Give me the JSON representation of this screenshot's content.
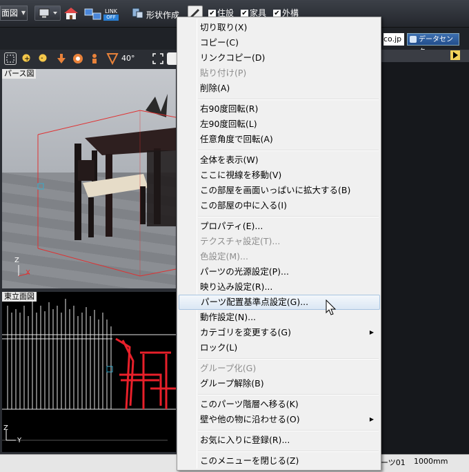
{
  "toolbar": {
    "view_select": "面図",
    "link_label": "LINK",
    "link_state": "OFF",
    "shape_label": "形状作成",
    "checks": [
      {
        "label": "住設",
        "checked": true
      },
      {
        "label": "家具",
        "checked": true
      },
      {
        "label": "外構",
        "checked": true
      }
    ]
  },
  "urlbar": {
    "url_text": "co.jp",
    "datacenter_label": "データセンター"
  },
  "viewbar": {
    "angle": "40°"
  },
  "panes": {
    "perspective_label": "パース図",
    "elevation_label": "東立面図"
  },
  "axes": {
    "z": "Z",
    "x": "X",
    "y": "Y"
  },
  "status": {
    "part_name": "ーツ01",
    "size": "1000mm"
  },
  "menu": {
    "items": [
      {
        "label": "切り取り(X)",
        "enabled": true
      },
      {
        "label": "コピー(C)",
        "enabled": true
      },
      {
        "label": "リンクコピー(D)",
        "enabled": true
      },
      {
        "label": "貼り付け(P)",
        "enabled": false
      },
      {
        "label": "削除(A)",
        "enabled": true
      },
      {
        "label": "右90度回転(R)",
        "enabled": true
      },
      {
        "label": "左90度回転(L)",
        "enabled": true
      },
      {
        "label": "任意角度で回転(A)",
        "enabled": true
      },
      {
        "label": "全体を表示(W)",
        "enabled": true
      },
      {
        "label": "ここに視線を移動(V)",
        "enabled": true
      },
      {
        "label": "この部屋を画面いっぱいに拡大する(B)",
        "enabled": true
      },
      {
        "label": "この部屋の中に入る(I)",
        "enabled": true
      },
      {
        "label": "プロパティ(E)...",
        "enabled": true
      },
      {
        "label": "テクスチャ設定(T)...",
        "enabled": false
      },
      {
        "label": "色設定(M)...",
        "enabled": false
      },
      {
        "label": "パーツの光源設定(P)...",
        "enabled": true
      },
      {
        "label": "映り込み設定(R)...",
        "enabled": true
      },
      {
        "label": "パーツ配置基準点設定(G)...",
        "enabled": true,
        "highlighted": true
      },
      {
        "label": "動作設定(N)...",
        "enabled": true
      },
      {
        "label": "カテゴリを変更する(G)",
        "enabled": true,
        "submenu": true
      },
      {
        "label": "ロック(L)",
        "enabled": true
      },
      {
        "label": "グループ化(G)",
        "enabled": false
      },
      {
        "label": "グループ解除(B)",
        "enabled": true
      },
      {
        "label": "このパーツ階層へ移る(K)",
        "enabled": true
      },
      {
        "label": "壁や他の物に沿わせる(O)",
        "enabled": true,
        "submenu": true
      },
      {
        "label": "お気に入りに登録(R)...",
        "enabled": true
      },
      {
        "label": "このメニューを閉じる(Z)",
        "enabled": true
      }
    ]
  },
  "colors": {
    "highlight": "#dbe7f4",
    "selection_box": "#e03030",
    "furniture_red": "#e8202a"
  }
}
